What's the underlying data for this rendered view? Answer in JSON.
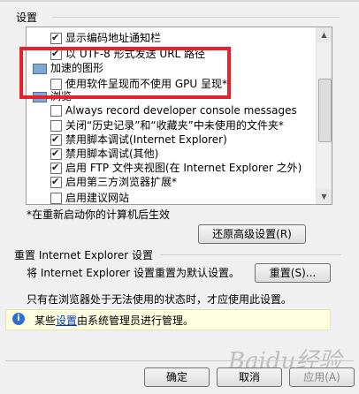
{
  "settings": {
    "group_label": "设置",
    "items": [
      {
        "type": "checkbox",
        "checked": true,
        "label": "显示编码地址通知栏"
      },
      {
        "type": "checkbox",
        "checked": true,
        "label": "以 UTF-8 形式发送 URL 路径"
      },
      {
        "type": "category",
        "label": "加速的图形"
      },
      {
        "type": "checkbox",
        "checked": false,
        "label": "使用软件呈现而不使用 GPU 呈现*"
      },
      {
        "type": "category",
        "label": "浏览"
      },
      {
        "type": "checkbox",
        "checked": false,
        "label": "Always record developer console messages"
      },
      {
        "type": "checkbox",
        "checked": false,
        "label": "关闭“历史记录”和“收藏夹”中未使用的文件夹*"
      },
      {
        "type": "checkbox",
        "checked": true,
        "label": "禁用脚本调试(Internet Explorer)"
      },
      {
        "type": "checkbox",
        "checked": true,
        "label": "禁用脚本调试(其他)"
      },
      {
        "type": "checkbox",
        "checked": true,
        "label": "启用 FTP 文件夹视图(在 Internet Explorer 之外)"
      },
      {
        "type": "checkbox",
        "checked": true,
        "label": "启用第三方浏览器扩展*"
      },
      {
        "type": "checkbox",
        "checked": false,
        "label": "启用建议网站"
      }
    ]
  },
  "restart_note": "*在重新启动你的计算机后生效",
  "restore_button": "还原高级设置(R)",
  "reset_section": {
    "label": "重置 Internet Explorer 设置",
    "text": "将 Internet Explorer 设置重置为默认设置。",
    "button": "重置(S)...",
    "note": "只有在浏览器处于无法使用的状态时，才应使用此设置。"
  },
  "infobar": {
    "icon": "info-icon",
    "prefix": "某些",
    "link": "设置",
    "suffix": "由系统管理员进行管理。"
  },
  "footer": {
    "ok": "确定",
    "cancel": "取消",
    "apply": "应用(A)"
  },
  "watermark": "Baidu经验",
  "colors": {
    "highlight_box": "#e8202b",
    "infobar_bg": "#ffffe1",
    "link": "#0033cc"
  }
}
